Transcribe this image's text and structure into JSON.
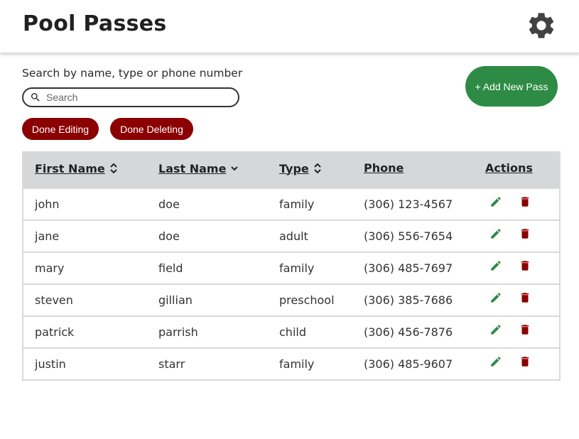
{
  "header": {
    "title": "Pool Passes",
    "settings_icon": "gear-icon"
  },
  "search": {
    "label": "Search by name, type or phone number",
    "placeholder": "Search",
    "value": "",
    "icon": "search-icon"
  },
  "buttons": {
    "done_editing": "Done Editing",
    "done_deleting": "Done Deleting",
    "add_new_pass": "+ Add New Pass"
  },
  "colors": {
    "danger": "#8b0000",
    "primary": "#2e8b45",
    "header_bg": "#d6d7d9"
  },
  "table": {
    "columns": [
      {
        "label": "First Name",
        "sort": "unsorted"
      },
      {
        "label": "Last Name",
        "sort": "descending"
      },
      {
        "label": "Type",
        "sort": "unsorted"
      },
      {
        "label": "Phone",
        "sort": "none"
      },
      {
        "label": "Actions",
        "sort": "none"
      }
    ],
    "rows": [
      {
        "first": "john",
        "last": "doe",
        "type": "family",
        "phone": "(306) 123-4567"
      },
      {
        "first": "jane",
        "last": "doe",
        "type": "adult",
        "phone": "(306) 556-7654"
      },
      {
        "first": "mary",
        "last": "field",
        "type": "family",
        "phone": "(306) 485-7697"
      },
      {
        "first": "steven",
        "last": "gillian",
        "type": "preschool",
        "phone": "(306) 385-7686"
      },
      {
        "first": "patrick",
        "last": "parrish",
        "type": "child",
        "phone": "(306) 456-7876"
      },
      {
        "first": "justin",
        "last": "starr",
        "type": "family",
        "phone": "(306) 485-9607"
      }
    ],
    "actions": {
      "edit_icon": "pencil-icon",
      "delete_icon": "trash-icon"
    }
  }
}
